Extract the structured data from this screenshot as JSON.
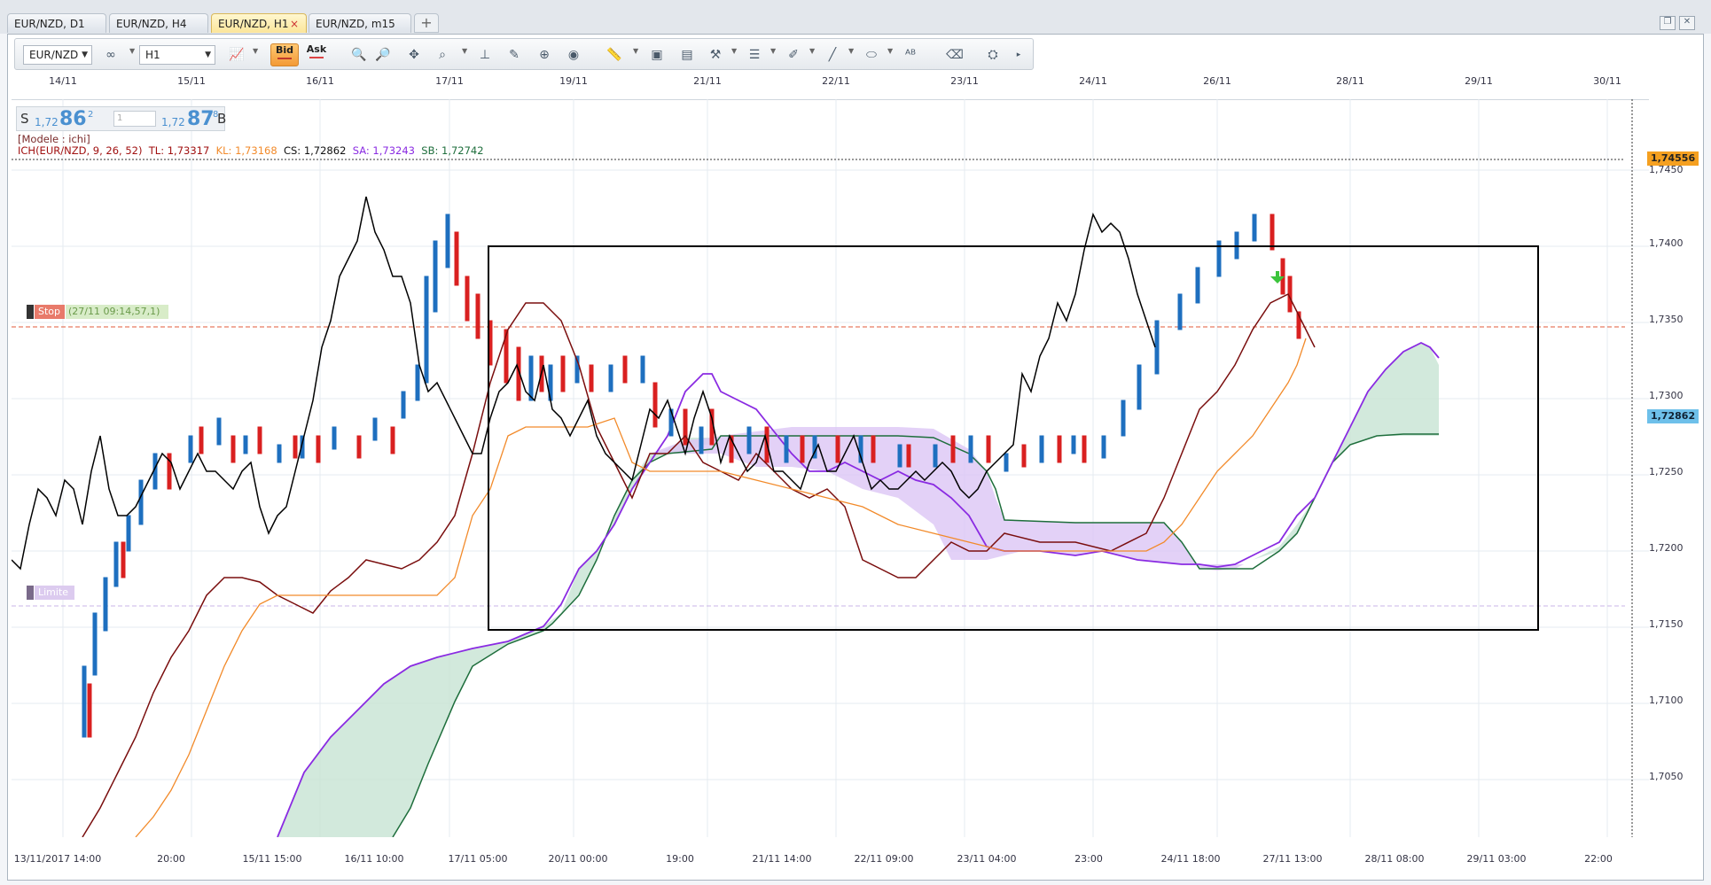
{
  "tabs": [
    {
      "label": "EUR/NZD, D1",
      "active": false
    },
    {
      "label": "EUR/NZD, H4",
      "active": false
    },
    {
      "label": "EUR/NZD, H1",
      "active": true,
      "close": "×"
    },
    {
      "label": "EUR/NZD, m15",
      "active": false
    }
  ],
  "tab_add": "+",
  "toolbar": {
    "symbol": "EUR/NZD",
    "timeframe": "H1",
    "bid_label": "Bid",
    "ask_label": "Ask",
    "icons": [
      "chart-type-icon",
      "link-icon",
      "zoom-icon",
      "zoom-out-icon",
      "cursor-icon",
      "magnifier-icon",
      "indicator-icon",
      "drawing-icon",
      "crosshair-icon",
      "globe-icon",
      "ruler-icon",
      "image-icon",
      "template-icon",
      "tools-icon",
      "lines-icon",
      "pencil-icon",
      "brush-icon",
      "ellipse-icon",
      "text-icon",
      "eraser-icon",
      "objects-icon",
      "more-icon"
    ]
  },
  "quote": {
    "sell_label": "S",
    "sell_prefix": "1,72",
    "sell_big": "86",
    "sell_sup": "2",
    "amount": "1",
    "buy_prefix": "1,72",
    "buy_big": "87",
    "buy_sup": "8",
    "buy_label": "B"
  },
  "legend": {
    "model": "[Modele : ichi]",
    "ich": "ICH(EUR/NZD, 9, 26, 52)",
    "tl": "TL: 1,73317",
    "kl": "KL: 1,73168",
    "cs": "CS: 1,72862",
    "sa": "SA: 1,73243",
    "sb": "SB: 1,72742"
  },
  "markers": {
    "stop_label": "Stop",
    "stop_info": "(27/11 09:14,57,1)",
    "limit_label": "Limite"
  },
  "date_axis": [
    "14/11",
    "15/11",
    "16/11",
    "17/11",
    "19/11",
    "21/11",
    "22/11",
    "23/11",
    "24/11",
    "26/11",
    "28/11",
    "29/11",
    "30/11"
  ],
  "price_axis": [
    "1,7450",
    "1,7400",
    "1,7350",
    "1,7300",
    "1,7250",
    "1,7200",
    "1,7150",
    "1,7100",
    "1,7050"
  ],
  "time_axis": [
    "13/11/2017 14:00",
    "20:00",
    "15/11 15:00",
    "16/11 10:00",
    "17/11 05:00",
    "20/11 00:00",
    "19:00",
    "21/11 14:00",
    "22/11 09:00",
    "23/11 04:00",
    "23:00",
    "24/11 18:00",
    "27/11 13:00",
    "28/11 08:00",
    "29/11 03:00",
    "22:00"
  ],
  "price_tags": {
    "top": "1,74556",
    "current": "1,72862"
  },
  "colors": {
    "tenkan": "#7a0e0e",
    "kijun": "#f28a2a",
    "chikou": "#000000",
    "senkou_a": "#8a2be2",
    "senkou_b": "#1e6e3c",
    "bull_candle": "#1e6fbf",
    "bear_candle": "#d92020",
    "stop_line": "#e05a3a",
    "limit_line": "#c9b6e8"
  }
}
